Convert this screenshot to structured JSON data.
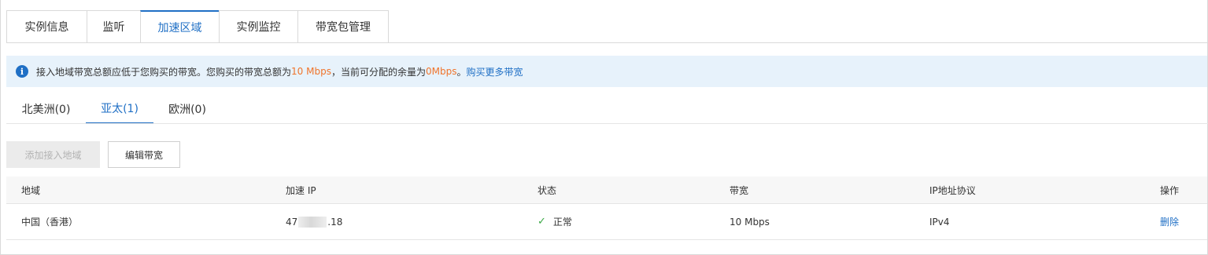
{
  "top_tabs": [
    {
      "label": "实例信息",
      "active": false
    },
    {
      "label": "监听",
      "active": false
    },
    {
      "label": "加速区域",
      "active": true
    },
    {
      "label": "实例监控",
      "active": false
    },
    {
      "label": "带宽包管理",
      "active": false
    }
  ],
  "notice": {
    "icon": "info-icon",
    "text_1": "接入地域带宽总额应低于您购买的带宽。您购买的带宽总额为",
    "total_bandwidth": "10 Mbps",
    "text_2": "，当前可分配的余量为",
    "remaining_bandwidth": "0Mbps",
    "text_3": "。",
    "link": "购买更多带宽"
  },
  "region_tabs": [
    {
      "label": "北美洲(0)",
      "active": false
    },
    {
      "label": "亚太(1)",
      "active": true
    },
    {
      "label": "欧洲(0)",
      "active": false
    }
  ],
  "actions": {
    "add_region": "添加接入地域",
    "edit_bandwidth": "编辑带宽"
  },
  "table": {
    "columns": [
      "地域",
      "加速 IP",
      "状态",
      "带宽",
      "IP地址协议",
      "操作"
    ],
    "rows": [
      {
        "region": "中国（香港）",
        "ip_prefix": "47",
        "ip_suffix": ".18",
        "status": "正常",
        "bandwidth": "10 Mbps",
        "protocol": "IPv4",
        "action": "删除"
      }
    ]
  },
  "colors": {
    "accent": "#1f6fc5",
    "highlight": "#f0742b",
    "success": "#3aa845",
    "notice_bg": "#e7f2fb"
  }
}
